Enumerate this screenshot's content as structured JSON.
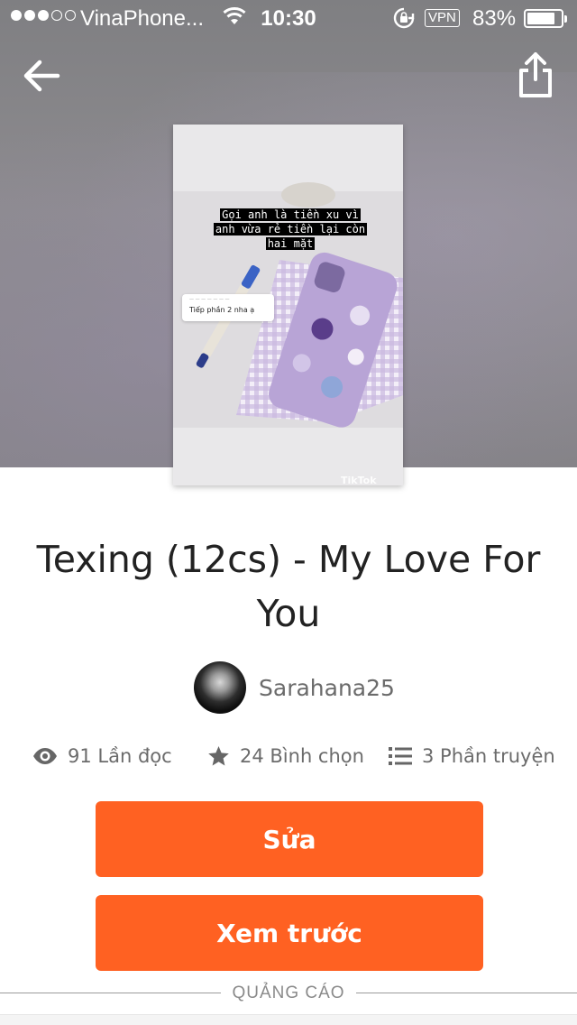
{
  "status_bar": {
    "carrier": "VinaPhone...",
    "time": "10:30",
    "vpn": "VPN",
    "battery_percent": "83%",
    "battery_level": 0.83
  },
  "header": {
    "back_icon": "arrow-left-icon",
    "share_icon": "share-icon"
  },
  "cover": {
    "caption_lines": [
      "Gọi anh là tiền xu vì",
      "anh vừa rẻ tiền lại còn",
      "hai mặt"
    ],
    "bubble_reply": "Tiếp phần 2 nha ạ",
    "watermark": "TikTok"
  },
  "story": {
    "title": "Texing (12cs) - My Love For You",
    "author": "Sarahana25"
  },
  "stats": {
    "reads": "91 Lần đọc",
    "votes": "24 Bình chọn",
    "parts": "3 Phần truyện"
  },
  "actions": {
    "edit_label": "Sửa",
    "preview_label": "Xem trước"
  },
  "ad": {
    "label": "QUẢNG CÁO"
  },
  "colors": {
    "accent": "#ff6122",
    "text_primary": "#222222",
    "text_secondary": "#6b6b6b"
  }
}
